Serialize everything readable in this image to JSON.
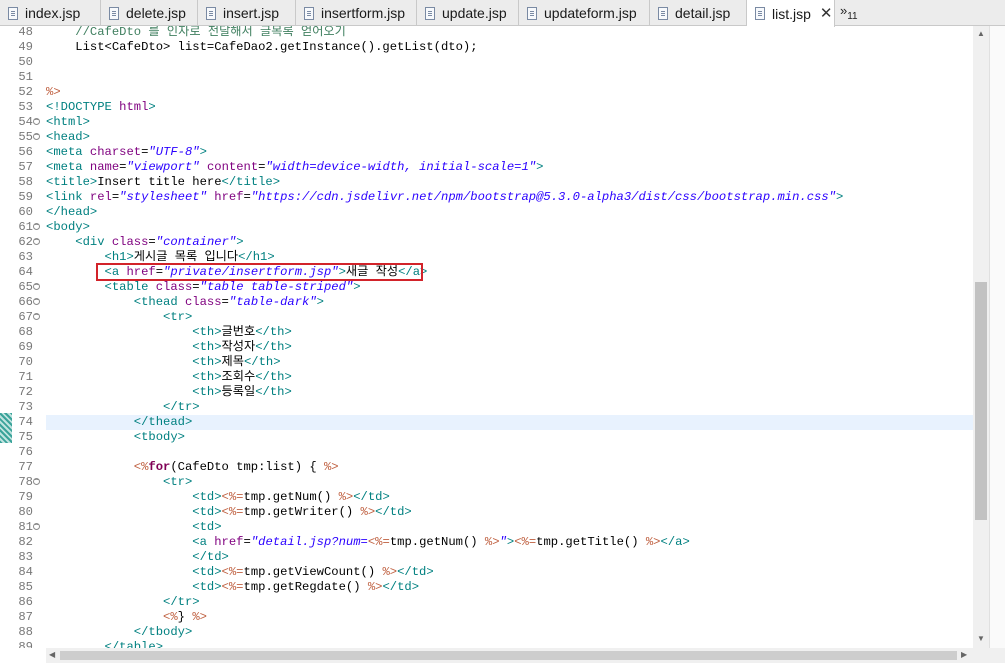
{
  "tabs": [
    {
      "label": "index.jsp"
    },
    {
      "label": "delete.jsp"
    },
    {
      "label": "insert.jsp"
    },
    {
      "label": "insertform.jsp"
    },
    {
      "label": "update.jsp"
    },
    {
      "label": "updateform.jsp"
    },
    {
      "label": "detail.jsp"
    },
    {
      "label": "list.jsp",
      "close": "✕"
    }
  ],
  "overflow": {
    "icon": "»",
    "count": "11"
  },
  "lines": [
    {
      "n": "48",
      "segs": [
        [
          "cm",
          "    //CafeDto 를 인자로 전달해서 글목록 얻어오기"
        ]
      ]
    },
    {
      "n": "49",
      "segs": [
        [
          "t",
          "    List<CafeDto> list=CafeDao2.getInstance().getList(dto);"
        ]
      ]
    },
    {
      "n": "50",
      "segs": []
    },
    {
      "n": "51",
      "segs": []
    },
    {
      "n": "52",
      "segs": [
        [
          "jd",
          "%>"
        ]
      ]
    },
    {
      "n": "53",
      "segs": [
        [
          "tg",
          "<!DOCTYPE "
        ],
        [
          "an",
          "html"
        ],
        [
          "tg",
          ">"
        ]
      ]
    },
    {
      "n": "54",
      "fold": true,
      "segs": [
        [
          "tg",
          "<html>"
        ]
      ]
    },
    {
      "n": "55",
      "fold": true,
      "segs": [
        [
          "tg",
          "<head>"
        ]
      ]
    },
    {
      "n": "56",
      "segs": [
        [
          "tg",
          "<meta "
        ],
        [
          "an",
          "charset"
        ],
        [
          "t",
          "="
        ],
        [
          "av",
          "\"UTF-8\""
        ],
        [
          "tg",
          ">"
        ]
      ]
    },
    {
      "n": "57",
      "segs": [
        [
          "tg",
          "<meta "
        ],
        [
          "an",
          "name"
        ],
        [
          "t",
          "="
        ],
        [
          "av",
          "\"viewport\""
        ],
        [
          "t",
          " "
        ],
        [
          "an",
          "content"
        ],
        [
          "t",
          "="
        ],
        [
          "av",
          "\"width=device-width, initial-scale=1\""
        ],
        [
          "tg",
          ">"
        ]
      ]
    },
    {
      "n": "58",
      "segs": [
        [
          "tg",
          "<title>"
        ],
        [
          "t",
          "Insert title here"
        ],
        [
          "tg",
          "</title>"
        ]
      ]
    },
    {
      "n": "59",
      "segs": [
        [
          "tg",
          "<link "
        ],
        [
          "an",
          "rel"
        ],
        [
          "t",
          "="
        ],
        [
          "av",
          "\"stylesheet\""
        ],
        [
          "t",
          " "
        ],
        [
          "an",
          "href"
        ],
        [
          "t",
          "="
        ],
        [
          "av",
          "\"https://cdn.jsdelivr.net/npm/bootstrap@5.3.0-alpha3/dist/css/bootstrap.min.css\""
        ],
        [
          "tg",
          ">"
        ]
      ]
    },
    {
      "n": "60",
      "segs": [
        [
          "tg",
          "</head>"
        ]
      ]
    },
    {
      "n": "61",
      "fold": true,
      "segs": [
        [
          "tg",
          "<body>"
        ]
      ]
    },
    {
      "n": "62",
      "fold": true,
      "segs": [
        [
          "t",
          "    "
        ],
        [
          "tg",
          "<div "
        ],
        [
          "an",
          "class"
        ],
        [
          "t",
          "="
        ],
        [
          "av",
          "\"container\""
        ],
        [
          "tg",
          ">"
        ]
      ]
    },
    {
      "n": "63",
      "segs": [
        [
          "t",
          "        "
        ],
        [
          "tg",
          "<h1>"
        ],
        [
          "t",
          "게시글 목록 입니다"
        ],
        [
          "tg",
          "</h1>"
        ]
      ]
    },
    {
      "n": "64",
      "segs": [
        [
          "t",
          "        "
        ],
        [
          "tg",
          "<a "
        ],
        [
          "an",
          "href"
        ],
        [
          "t",
          "="
        ],
        [
          "av",
          "\"private/insertform.jsp\""
        ],
        [
          "tg",
          ">"
        ],
        [
          "t",
          "새글 작성"
        ],
        [
          "tg",
          "</a>"
        ]
      ]
    },
    {
      "n": "65",
      "fold": true,
      "segs": [
        [
          "t",
          "        "
        ],
        [
          "tg",
          "<table "
        ],
        [
          "an",
          "class"
        ],
        [
          "t",
          "="
        ],
        [
          "av",
          "\"table table-striped\""
        ],
        [
          "tg",
          ">"
        ]
      ]
    },
    {
      "n": "66",
      "fold": true,
      "segs": [
        [
          "t",
          "            "
        ],
        [
          "tg",
          "<thead "
        ],
        [
          "an",
          "class"
        ],
        [
          "t",
          "="
        ],
        [
          "av",
          "\"table-dark\""
        ],
        [
          "tg",
          ">"
        ]
      ]
    },
    {
      "n": "67",
      "fold": true,
      "segs": [
        [
          "t",
          "                "
        ],
        [
          "tg",
          "<tr>"
        ]
      ]
    },
    {
      "n": "68",
      "segs": [
        [
          "t",
          "                    "
        ],
        [
          "tg",
          "<th>"
        ],
        [
          "t",
          "글번호"
        ],
        [
          "tg",
          "</th>"
        ]
      ]
    },
    {
      "n": "69",
      "segs": [
        [
          "t",
          "                    "
        ],
        [
          "tg",
          "<th>"
        ],
        [
          "t",
          "작성자"
        ],
        [
          "tg",
          "</th>"
        ]
      ]
    },
    {
      "n": "70",
      "segs": [
        [
          "t",
          "                    "
        ],
        [
          "tg",
          "<th>"
        ],
        [
          "t",
          "제목"
        ],
        [
          "tg",
          "</th>"
        ]
      ]
    },
    {
      "n": "71",
      "segs": [
        [
          "t",
          "                    "
        ],
        [
          "tg",
          "<th>"
        ],
        [
          "t",
          "조회수"
        ],
        [
          "tg",
          "</th>"
        ]
      ]
    },
    {
      "n": "72",
      "segs": [
        [
          "t",
          "                    "
        ],
        [
          "tg",
          "<th>"
        ],
        [
          "t",
          "등록일"
        ],
        [
          "tg",
          "</th>"
        ]
      ]
    },
    {
      "n": "73",
      "segs": [
        [
          "t",
          "                "
        ],
        [
          "tg",
          "</tr>"
        ]
      ]
    },
    {
      "n": "74",
      "current": true,
      "segs": [
        [
          "t",
          "            "
        ],
        [
          "tg",
          "</thead>"
        ]
      ]
    },
    {
      "n": "75",
      "segs": [
        [
          "t",
          "            "
        ],
        [
          "tg",
          "<tbody>"
        ]
      ]
    },
    {
      "n": "76",
      "segs": []
    },
    {
      "n": "77",
      "segs": [
        [
          "t",
          "            "
        ],
        [
          "jd",
          "<%"
        ],
        [
          "kw",
          "for"
        ],
        [
          "t",
          "(CafeDto tmp:list) { "
        ],
        [
          "jd",
          "%>"
        ]
      ]
    },
    {
      "n": "78",
      "fold": true,
      "segs": [
        [
          "t",
          "                "
        ],
        [
          "tg",
          "<tr>"
        ]
      ]
    },
    {
      "n": "79",
      "segs": [
        [
          "t",
          "                    "
        ],
        [
          "tg",
          "<td>"
        ],
        [
          "jd",
          "<%="
        ],
        [
          "t",
          "tmp.getNum() "
        ],
        [
          "jd",
          "%>"
        ],
        [
          "tg",
          "</td>"
        ]
      ]
    },
    {
      "n": "80",
      "segs": [
        [
          "t",
          "                    "
        ],
        [
          "tg",
          "<td>"
        ],
        [
          "jd",
          "<%="
        ],
        [
          "t",
          "tmp.getWriter() "
        ],
        [
          "jd",
          "%>"
        ],
        [
          "tg",
          "</td>"
        ]
      ]
    },
    {
      "n": "81",
      "fold": true,
      "segs": [
        [
          "t",
          "                    "
        ],
        [
          "tg",
          "<td>"
        ]
      ]
    },
    {
      "n": "82",
      "segs": [
        [
          "t",
          "                    "
        ],
        [
          "tg",
          "<a "
        ],
        [
          "an",
          "href"
        ],
        [
          "t",
          "="
        ],
        [
          "av",
          "\"detail.jsp?num="
        ],
        [
          "jd",
          "<%="
        ],
        [
          "t",
          "tmp.getNum() "
        ],
        [
          "jd",
          "%>"
        ],
        [
          "av",
          "\""
        ],
        [
          "tg",
          ">"
        ],
        [
          "jd",
          "<%="
        ],
        [
          "t",
          "tmp.getTitle() "
        ],
        [
          "jd",
          "%>"
        ],
        [
          "tg",
          "</a>"
        ]
      ]
    },
    {
      "n": "83",
      "segs": [
        [
          "t",
          "                    "
        ],
        [
          "tg",
          "</td>"
        ]
      ]
    },
    {
      "n": "84",
      "segs": [
        [
          "t",
          "                    "
        ],
        [
          "tg",
          "<td>"
        ],
        [
          "jd",
          "<%="
        ],
        [
          "t",
          "tmp.getViewCount() "
        ],
        [
          "jd",
          "%>"
        ],
        [
          "tg",
          "</td>"
        ]
      ]
    },
    {
      "n": "85",
      "segs": [
        [
          "t",
          "                    "
        ],
        [
          "tg",
          "<td>"
        ],
        [
          "jd",
          "<%="
        ],
        [
          "t",
          "tmp.getRegdate() "
        ],
        [
          "jd",
          "%>"
        ],
        [
          "tg",
          "</td>"
        ]
      ]
    },
    {
      "n": "86",
      "segs": [
        [
          "t",
          "                "
        ],
        [
          "tg",
          "</tr>"
        ]
      ]
    },
    {
      "n": "87",
      "segs": [
        [
          "t",
          "                "
        ],
        [
          "jd",
          "<%"
        ],
        [
          "t",
          "} "
        ],
        [
          "jd",
          "%>"
        ]
      ]
    },
    {
      "n": "88",
      "segs": [
        [
          "t",
          "            "
        ],
        [
          "tg",
          "</tbody>"
        ]
      ]
    },
    {
      "n": "89",
      "segs": [
        [
          "t",
          "        "
        ],
        [
          "tg",
          "</table>"
        ]
      ]
    }
  ]
}
